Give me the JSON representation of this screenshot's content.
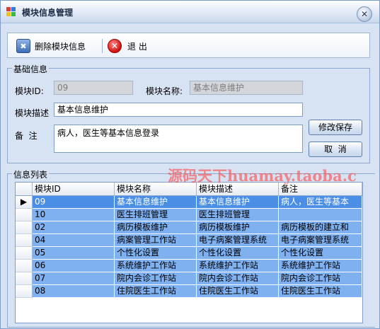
{
  "window": {
    "title": "模块信息管理"
  },
  "toolbar": {
    "delete_label": "删除模块信息",
    "exit_label": "退 出"
  },
  "basic_info": {
    "group_title": "基础信息",
    "module_id_label": "模块ID:",
    "module_id_value": "09",
    "module_name_label": "模块名称:",
    "module_name_value": "基本信息维护",
    "module_desc_label": "模块描述",
    "module_desc_value": "基本信息维护",
    "remark_label": "备  注",
    "remark_value": "病人，医生等基本信息登录",
    "save_label": "修改保存",
    "cancel_label": "取  消"
  },
  "list": {
    "group_title": "信息列表",
    "columns": [
      "模块ID",
      "模块名称",
      "模块描述",
      "备注"
    ],
    "selected_indicator": "▶",
    "rows": [
      [
        "09",
        "基本信息维护",
        "基本信息维护",
        "病人，医生等基本"
      ],
      [
        "10",
        "医生排班管理",
        "医生排班管理",
        ""
      ],
      [
        "02",
        "病历模板维护",
        "病历模板维护",
        "病历模板的建立和"
      ],
      [
        "04",
        "病案管理工作站",
        "电子病案管理系统",
        "电子病案管理系统"
      ],
      [
        "05",
        "个性化设置",
        "个性化设置",
        "个性化设置"
      ],
      [
        "06",
        "系统维护工作站",
        "系统维护工作站",
        "系统维护工作站"
      ],
      [
        "07",
        "院内会诊工作站",
        "院内会诊工作站",
        "院内会诊工作站"
      ],
      [
        "08",
        "住院医生工作站",
        "住院医生工作站",
        "住院医生工作站"
      ]
    ]
  },
  "watermark": "源码天下huamay.taoba.c",
  "colors": {
    "row_bg": "#7fb0f0",
    "selected_row_bg": "#4b8ee6",
    "window_bg": "#d7e3f3"
  }
}
